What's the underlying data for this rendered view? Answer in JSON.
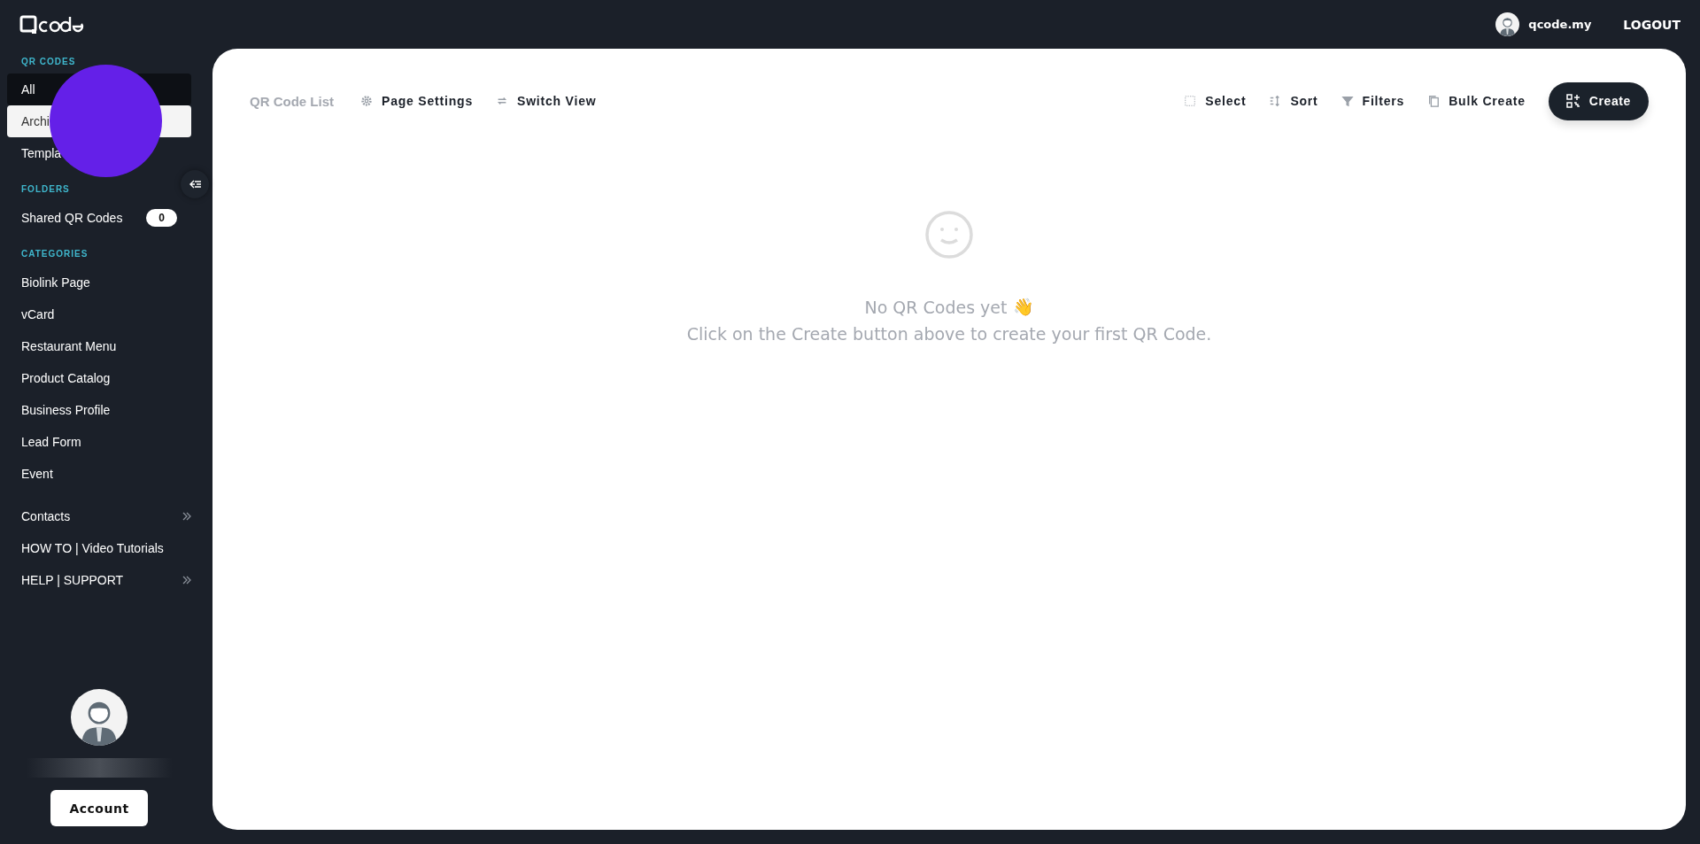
{
  "topbar": {
    "user": "qcode.my",
    "logout": "LOGOUT"
  },
  "sidebar": {
    "sections": [
      {
        "heading": "QR CODES",
        "items": [
          {
            "label": "All",
            "selected": false,
            "hover": true
          },
          {
            "label": "Archi",
            "selected": true,
            "hover": false
          },
          {
            "label": "Templa",
            "selected": false,
            "hover": false
          }
        ]
      },
      {
        "heading": "FOLDERS",
        "items": [
          {
            "label": "Shared QR Codes",
            "selected": false,
            "hover": false,
            "count": "0"
          }
        ]
      },
      {
        "heading": "CATEGORIES",
        "items": [
          {
            "label": "Biolink Page",
            "selected": false,
            "hover": false
          },
          {
            "label": "vCard",
            "selected": false,
            "hover": false
          },
          {
            "label": "Restaurant Menu",
            "selected": false,
            "hover": false
          },
          {
            "label": "Product Catalog",
            "selected": false,
            "hover": false
          },
          {
            "label": "Business Profile",
            "selected": false,
            "hover": false
          },
          {
            "label": "Lead Form",
            "selected": false,
            "hover": false
          },
          {
            "label": "Event",
            "selected": false,
            "hover": false
          }
        ]
      }
    ],
    "links": [
      {
        "label": "Contacts",
        "expandable": true
      },
      {
        "label": "HOW TO | Video Tutorials",
        "expandable": false
      },
      {
        "label": "HELP | SUPPORT",
        "expandable": true
      }
    ],
    "account_button": "Account"
  },
  "toolbar": {
    "title": "QR Code List",
    "left": [
      "Page Settings",
      "Switch View"
    ],
    "right": [
      "Select",
      "Sort",
      "Filters",
      "Bulk Create"
    ],
    "create": "Create"
  },
  "empty_state": {
    "title": "No QR Codes yet",
    "emoji": "👋",
    "message": "Click on the Create button above to create your first QR Code."
  }
}
